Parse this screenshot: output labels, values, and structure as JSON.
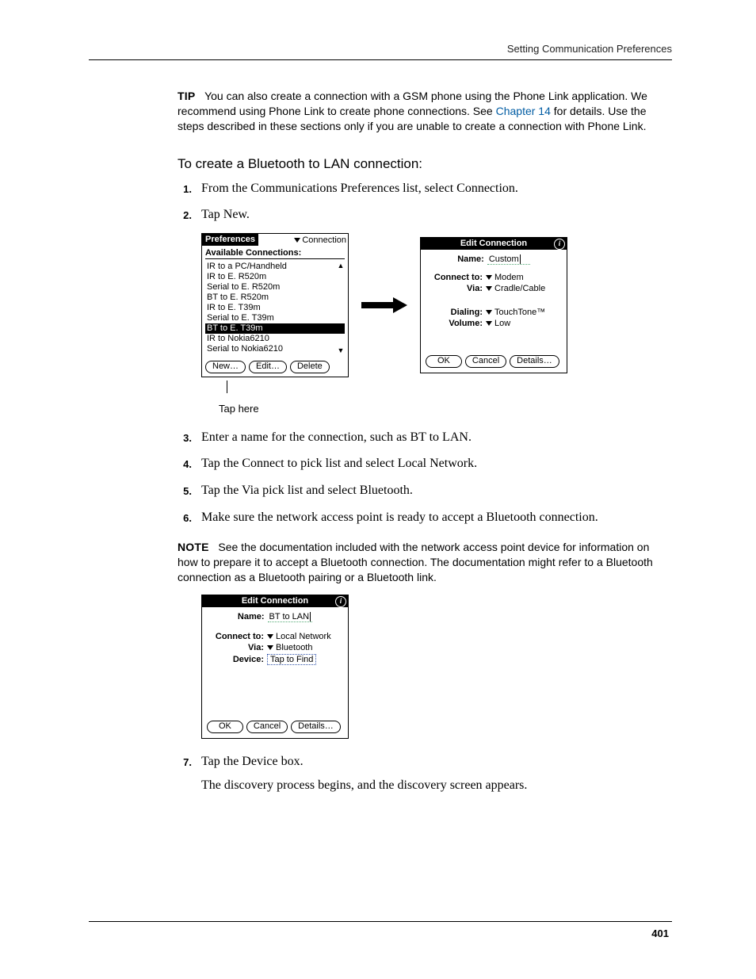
{
  "running_head": "Setting Communication Preferences",
  "page_number": "401",
  "tip": {
    "label": "TIP",
    "text_before_link": "You can also create a connection with a GSM phone using the Phone Link application. We recommend using Phone Link to create phone connections. See ",
    "link": "Chapter 14",
    "text_after_link": " for details. Use the steps described in these sections only if you are unable to create a connection with Phone Link."
  },
  "procedure_title": "To create a Bluetooth to LAN connection:",
  "steps": {
    "s1": "From the Communications Preferences list, select Connection.",
    "s2": "Tap New.",
    "s3": "Enter a name for the connection, such as BT to LAN.",
    "s4": "Tap the Connect to pick list and select Local Network.",
    "s5": "Tap the Via pick list and select Bluetooth.",
    "s6": "Make sure the network access point is ready to accept a Bluetooth connection.",
    "s7": "Tap the Device box.",
    "s7_follow": "The discovery process begins, and the discovery screen appears."
  },
  "note": {
    "label": "NOTE",
    "text": "See the documentation included with the network access point device for information on how to prepare it to accept a Bluetooth connection. The documentation might refer to a Bluetooth connection as a Bluetooth pairing or a Bluetooth link."
  },
  "callout": "Tap here",
  "palm_prefs": {
    "title_tab": "Preferences",
    "menu": "Connection",
    "section": "Available Connections:",
    "items": [
      "IR to a PC/Handheld",
      "IR to E. R520m",
      "Serial to E. R520m",
      "BT to E. R520m",
      "IR to E. T39m",
      "Serial to E. T39m",
      "BT to E. T39m",
      "IR to Nokia6210",
      "Serial to Nokia6210"
    ],
    "selected_index": 6,
    "btn_new": "New…",
    "btn_edit": "Edit…",
    "btn_delete": "Delete"
  },
  "palm_edit1": {
    "title": "Edit Connection",
    "name_label": "Name:",
    "name_value": "Custom",
    "connect_label": "Connect to:",
    "connect_value": "Modem",
    "via_label": "Via:",
    "via_value": "Cradle/Cable",
    "dialing_label": "Dialing:",
    "dialing_value": "TouchTone™",
    "volume_label": "Volume:",
    "volume_value": "Low",
    "btn_ok": "OK",
    "btn_cancel": "Cancel",
    "btn_details": "Details…"
  },
  "palm_edit2": {
    "title": "Edit Connection",
    "name_label": "Name:",
    "name_value": "BT to LAN",
    "connect_label": "Connect to:",
    "connect_value": "Local Network",
    "via_label": "Via:",
    "via_value": "Bluetooth",
    "device_label": "Device:",
    "device_value": "Tap to Find",
    "btn_ok": "OK",
    "btn_cancel": "Cancel",
    "btn_details": "Details…"
  }
}
